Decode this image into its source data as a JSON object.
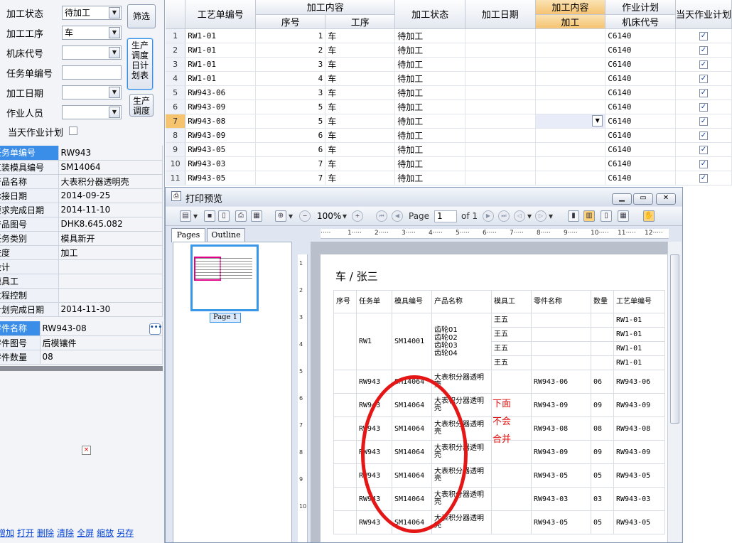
{
  "filter": {
    "labels": [
      "加工状态",
      "加工工序",
      "机床代号",
      "任务单编号",
      "加工日期",
      "作业人员"
    ],
    "status_value": "待加工",
    "process_value": "车",
    "today_plan_label": "当天作业计划",
    "filter_button": "筛选",
    "daily_plan_button": "生产调度日计划表",
    "dispatch_button": "生产调度"
  },
  "props": [
    {
      "k": "任务单编号",
      "v": "RW943"
    },
    {
      "k": "工装模具编号",
      "v": "SM14064"
    },
    {
      "k": "产品名称",
      "v": "大表积分器透明壳"
    },
    {
      "k": "承接日期",
      "v": "2014-09-25"
    },
    {
      "k": "要求完成日期",
      "v": "2014-11-10"
    },
    {
      "k": "产品图号",
      "v": "DHK8.645.082"
    },
    {
      "k": "任务类别",
      "v": "模具新开"
    },
    {
      "k": "进度",
      "v": "加工"
    },
    {
      "k": "设计",
      "v": ""
    },
    {
      "k": "模具工",
      "v": ""
    },
    {
      "k": "过程控制",
      "v": ""
    },
    {
      "k": "计划完成日期",
      "v": "2014-11-30"
    }
  ],
  "props2": [
    {
      "k": "零件名称",
      "v": "RW943-08"
    },
    {
      "k": "零件图号",
      "v": "后模镶件"
    },
    {
      "k": "零件数量",
      "v": "08"
    }
  ],
  "links": [
    "增加",
    "打开",
    "删除",
    "清除",
    "全屏",
    "缩放",
    "另存"
  ],
  "grid": {
    "headers": {
      "process_order": "工艺单编号",
      "group_content": "加工内容",
      "seq": "序号",
      "op": "工序",
      "status": "加工状态",
      "date": "加工日期",
      "group_content2": "加工内容",
      "content": "加工",
      "group_plan": "作业计划",
      "machine": "机床代号",
      "today": "当天作业计划"
    },
    "rows": [
      {
        "n": "1",
        "order": "RW1-01",
        "seq": "1",
        "op": "车",
        "status": "待加工",
        "machine": "C6140"
      },
      {
        "n": "2",
        "order": "RW1-01",
        "seq": "2",
        "op": "车",
        "status": "待加工",
        "machine": "C6140"
      },
      {
        "n": "3",
        "order": "RW1-01",
        "seq": "3",
        "op": "车",
        "status": "待加工",
        "machine": "C6140"
      },
      {
        "n": "4",
        "order": "RW1-01",
        "seq": "4",
        "op": "车",
        "status": "待加工",
        "machine": "C6140"
      },
      {
        "n": "5",
        "order": "RW943-06",
        "seq": "3",
        "op": "车",
        "status": "待加工",
        "machine": "C6140"
      },
      {
        "n": "6",
        "order": "RW943-09",
        "seq": "5",
        "op": "车",
        "status": "待加工",
        "machine": "C6140"
      },
      {
        "n": "7",
        "order": "RW943-08",
        "seq": "5",
        "op": "车",
        "status": "待加工",
        "machine": "C6140"
      },
      {
        "n": "8",
        "order": "RW943-09",
        "seq": "6",
        "op": "车",
        "status": "待加工",
        "machine": "C6140"
      },
      {
        "n": "9",
        "order": "RW943-05",
        "seq": "6",
        "op": "车",
        "status": "待加工",
        "machine": "C6140"
      },
      {
        "n": "10",
        "order": "RW943-03",
        "seq": "7",
        "op": "车",
        "status": "待加工",
        "machine": "C6140"
      },
      {
        "n": "11",
        "order": "RW943-05",
        "seq": "7",
        "op": "车",
        "status": "待加工",
        "machine": "C6140"
      }
    ]
  },
  "preview": {
    "window_title": "打印预览",
    "zoom": "100%",
    "page_label": "Page",
    "page_value": "1",
    "of_label": "of 1",
    "tab_pages": "Pages",
    "tab_outline": "Outline",
    "thumb_label": "Page 1",
    "report_title": "车 / 张三",
    "report_headers": [
      "序号",
      "任务单",
      "模具编号",
      "产品名称",
      "模具工",
      "零件名称",
      "数量",
      "工艺单编号"
    ],
    "group1": {
      "task": "RW1",
      "mold": "SM14001",
      "products": [
        "齿轮01",
        "齿轮02",
        "齿轮03",
        "齿轮04"
      ],
      "workers": [
        "王五",
        "王五",
        "王五",
        "王五"
      ],
      "orders": [
        "RW1-01",
        "RW1-01",
        "RW1-01",
        "RW1-01"
      ]
    },
    "rows2": [
      {
        "task": "RW943",
        "mold": "SM14064",
        "product": "大表积分器透明壳",
        "part": "RW943-06",
        "qty": "06",
        "order": "RW943-06"
      },
      {
        "task": "RW943",
        "mold": "SM14064",
        "product": "大表积分器透明壳",
        "part": "RW943-09",
        "qty": "09",
        "order": "RW943-09"
      },
      {
        "task": "RW943",
        "mold": "SM14064",
        "product": "大表积分器透明壳",
        "part": "RW943-08",
        "qty": "08",
        "order": "RW943-08"
      },
      {
        "task": "RW943",
        "mold": "SM14064",
        "product": "大表积分器透明壳",
        "part": "RW943-09",
        "qty": "09",
        "order": "RW943-09"
      },
      {
        "task": "RW943",
        "mold": "SM14064",
        "product": "大表积分器透明壳",
        "part": "RW943-05",
        "qty": "05",
        "order": "RW943-05"
      },
      {
        "task": "RW943",
        "mold": "SM14064",
        "product": "大表积分器透明壳",
        "part": "RW943-03",
        "qty": "03",
        "order": "RW943-03"
      },
      {
        "task": "RW943",
        "mold": "SM14064",
        "product": "大表积分器透明壳",
        "part": "RW943-05",
        "qty": "05",
        "order": "RW943-05"
      }
    ],
    "annotation": [
      "下面",
      "不会",
      "合并"
    ]
  },
  "colors": {
    "selected_blue": "#3b8ee8",
    "header_orange": "#f5c371",
    "annotation_red": "#e01010"
  }
}
